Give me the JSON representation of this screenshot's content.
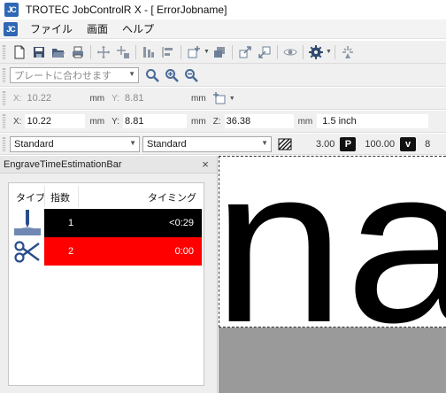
{
  "window": {
    "logo_text": "JC",
    "title": "TROTEC JobControlR X - [ ErrorJobname]"
  },
  "menu": {
    "items": [
      "ファイル",
      "画面",
      "ヘルプ"
    ]
  },
  "zoom_toolbar": {
    "zoom_select": "プレートに合わせます"
  },
  "position_toolbar_disabled": {
    "x_label": "X:",
    "x_value": "10.22",
    "x_unit": "mm",
    "y_label": "Y:",
    "y_value": "8.81",
    "y_unit": "mm"
  },
  "position_toolbar": {
    "x_label": "X:",
    "x_value": "10.22",
    "x_unit": "mm",
    "y_label": "Y:",
    "y_value": "8.81",
    "y_unit": "mm",
    "z_label": "Z:",
    "z_value": "36.38",
    "z_unit": "mm",
    "thickness": "1.5 inch"
  },
  "process_toolbar": {
    "material_select": "Standard",
    "process_select": "Standard",
    "value_1": "3.00",
    "power_badge": "P",
    "power_value": "100.00",
    "velocity_badge": "v",
    "velocity_value": "8"
  },
  "engrave_panel": {
    "title": "EngraveTimeEstimationBar",
    "close_glyph": "×",
    "columns": {
      "type": "タイプ",
      "index": "指数",
      "timing": "タイミング"
    },
    "rows": [
      {
        "type_icon": "engrave-icon",
        "index": "1",
        "timing": "<0:29",
        "color": "#000000"
      },
      {
        "type_icon": "cut-icon",
        "index": "2",
        "timing": "0:00",
        "color": "#ff0000"
      }
    ]
  },
  "canvas": {
    "preview_text": "na"
  }
}
